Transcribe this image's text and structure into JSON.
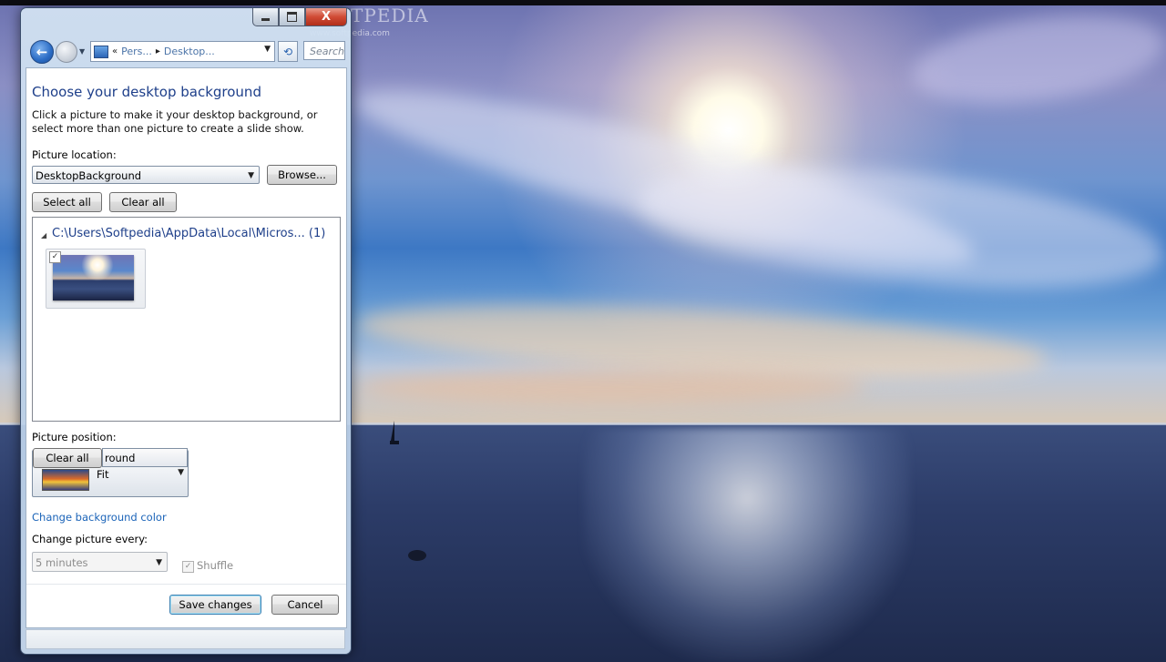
{
  "window": {
    "caption_buttons": {
      "minimize_icon": "minimize-icon",
      "maximize_icon": "maximize-icon",
      "close_label": "X"
    },
    "navigation": {
      "address_prefix": "«",
      "breadcrumbs": [
        "Pers...",
        "Desktop..."
      ],
      "search_placeholder": "Search"
    },
    "page": {
      "heading": "Choose your desktop background",
      "description": "Click a picture to make it your desktop background, or select more than one picture to create a slide show.",
      "picture_location_label": "Picture location:",
      "picture_location_value": "DesktopBackground",
      "browse_label": "Browse...",
      "select_all_label": "Select all",
      "clear_all_label": "Clear all",
      "group_header": "C:\\Users\\Softpedia\\AppData\\Local\\Micros... (1)",
      "thumbnail_checked": "✓",
      "picture_position_label": "Picture position:",
      "picture_position_value": "Fit",
      "overlay_clear_all_label": "Clear all",
      "overlay_field_text": "round",
      "change_background_color_link": "Change background color",
      "change_picture_every_label": "Change picture every:",
      "interval_value": "5 minutes",
      "shuffle_label": "Shuffle",
      "shuffle_checked": "✓",
      "save_changes_label": "Save changes",
      "cancel_label": "Cancel"
    }
  },
  "desktop": {
    "watermark": "SOFTPEDIA",
    "watermark_url": "www.softpedia.com"
  },
  "colors": {
    "heading_blue": "#1e3f8a",
    "link_blue": "#1a63b8",
    "close_red": "#d04b35"
  }
}
